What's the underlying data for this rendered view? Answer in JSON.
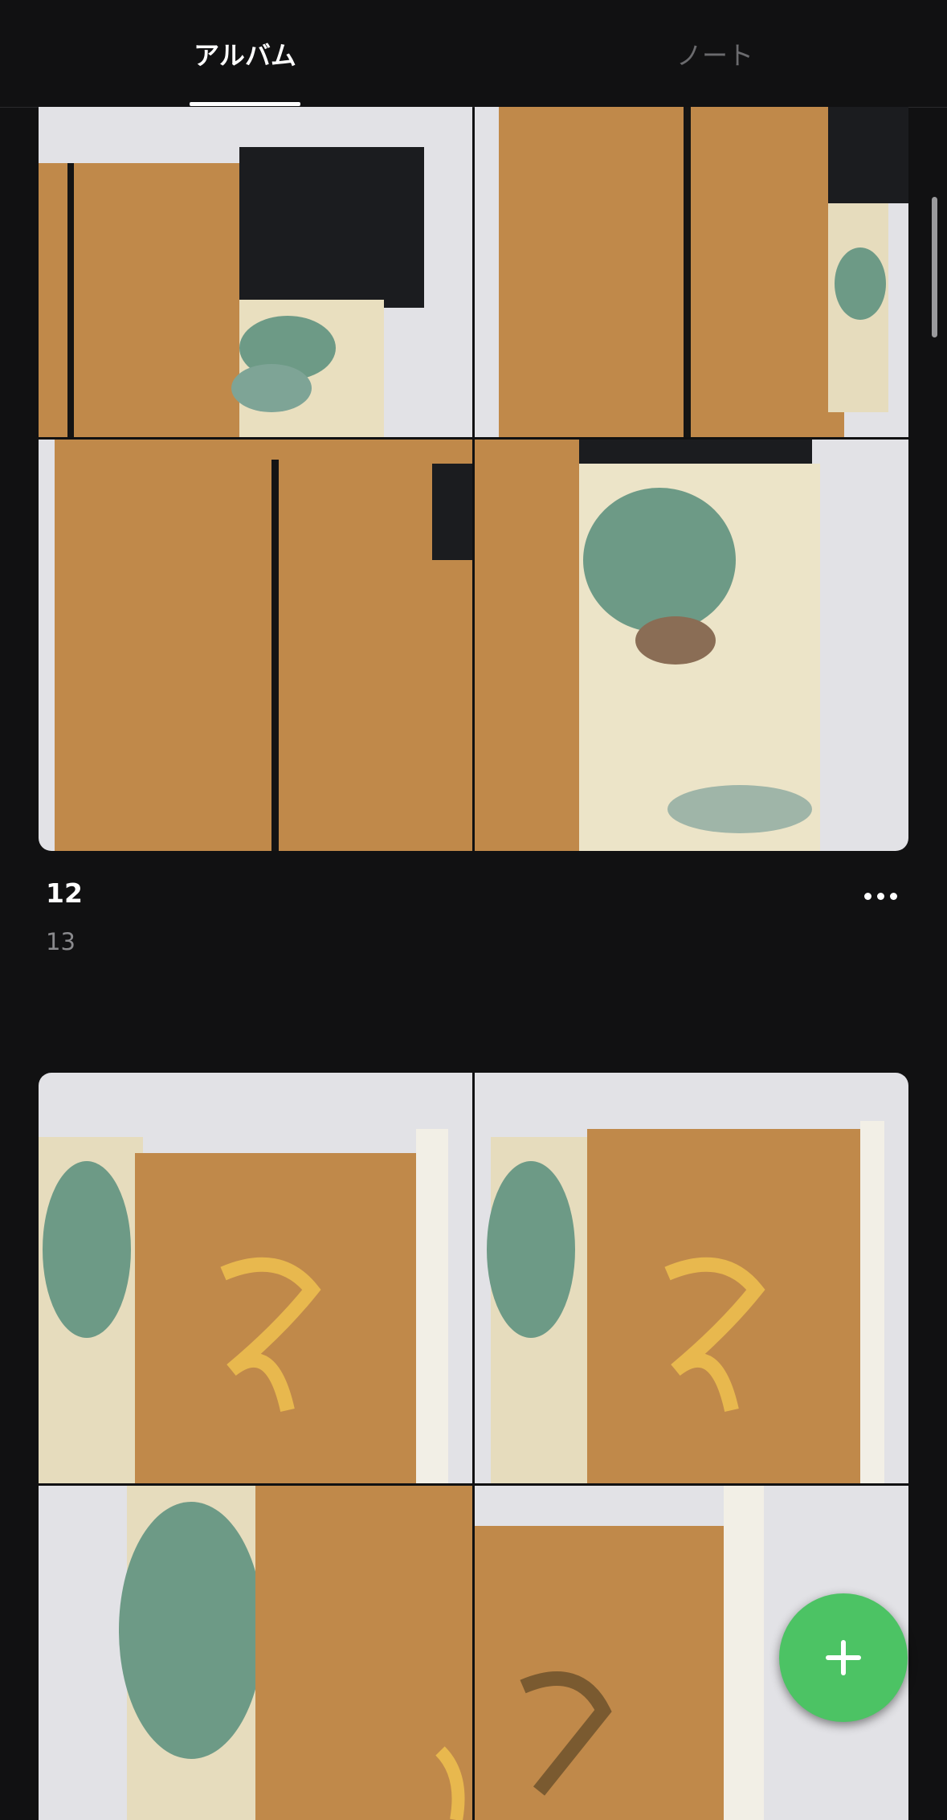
{
  "tabs": [
    {
      "label": "アルバム",
      "active": true
    },
    {
      "label": "ノート",
      "active": false
    }
  ],
  "albums": [
    {
      "name": "12",
      "count": "13"
    }
  ],
  "colors": {
    "background": "#111112",
    "accent": "#4cc364",
    "pillow_gold": "#c08a45",
    "pine_green": "#6d9a86",
    "black_fabric": "#1b1c1f"
  },
  "icons": {
    "more": "more-horizontal-icon",
    "add": "plus-icon"
  }
}
